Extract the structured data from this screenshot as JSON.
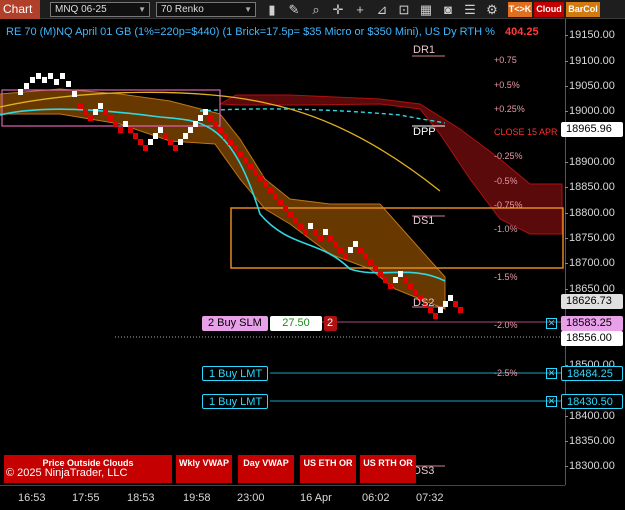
{
  "toolbar": {
    "tab_label": "Chart",
    "instrument": "MNQ 06-25",
    "period": "70 Renko",
    "buttons": [
      "T<>K",
      "Cloud",
      "BarCol"
    ],
    "colors": {
      "tk": "#e07020",
      "cloud": "#c00000",
      "barcol": "#d07a10"
    }
  },
  "chart_info": {
    "line": "RE 70 (M)NQ April 01 GB (1%=220p=$440) (1 Brick=17.5p= $35 Micro or $350 Mini), US Dy RTH %",
    "tail": "404.25"
  },
  "levels": {
    "dr1": "DR1",
    "dpp": "DPP",
    "ds1": "DS1",
    "ds2": "DS2",
    "ds3": "DS3",
    "close_label": "CLOSE 15 APR"
  },
  "percents": [
    "+0.75",
    "+0.5%",
    "+0.25%",
    "-0.25%",
    "-0.5%",
    "-0.75%",
    "-1.0%",
    "-1.5%",
    "-2.0%",
    "-2.5%"
  ],
  "price_axis": {
    "ticks": [
      "19150.00",
      "19100.00",
      "19050.00",
      "19000.00",
      "18950.00",
      "18900.00",
      "18850.00",
      "18800.00",
      "18750.00",
      "18700.00",
      "18650.00",
      "18550.00",
      "18500.00",
      "18450.00",
      "18400.00",
      "18350.00",
      "18300.00"
    ],
    "markers": {
      "m1": "18965.96",
      "m2": "18626.73",
      "m3": "18583.25",
      "m4": "18556.00",
      "m5": "18484.25",
      "m6": "18430.50"
    }
  },
  "time_axis": [
    "16:53",
    "17:55",
    "18:53",
    "19:58",
    "23:00",
    "16 Apr",
    "06:02",
    "07:32"
  ],
  "orders": {
    "buy_slm_label": "2 Buy SLM",
    "buy_slm_price": "27.50",
    "buy_slm_qty": "2",
    "buy_lmt_1": "1 Buy LMT",
    "buy_lmt_2": "1 Buy LMT",
    "close_glyph": "✕"
  },
  "bottom_buttons": {
    "price_outside": "Price Outside Clouds",
    "wkly_vwap": "Wkly VWAP",
    "day_vwap": "Day VWAP",
    "us_eth": "US ETH OR",
    "us_rth": "US RTH OR"
  },
  "copyright": "© 2025 NinjaTrader, LLC"
}
